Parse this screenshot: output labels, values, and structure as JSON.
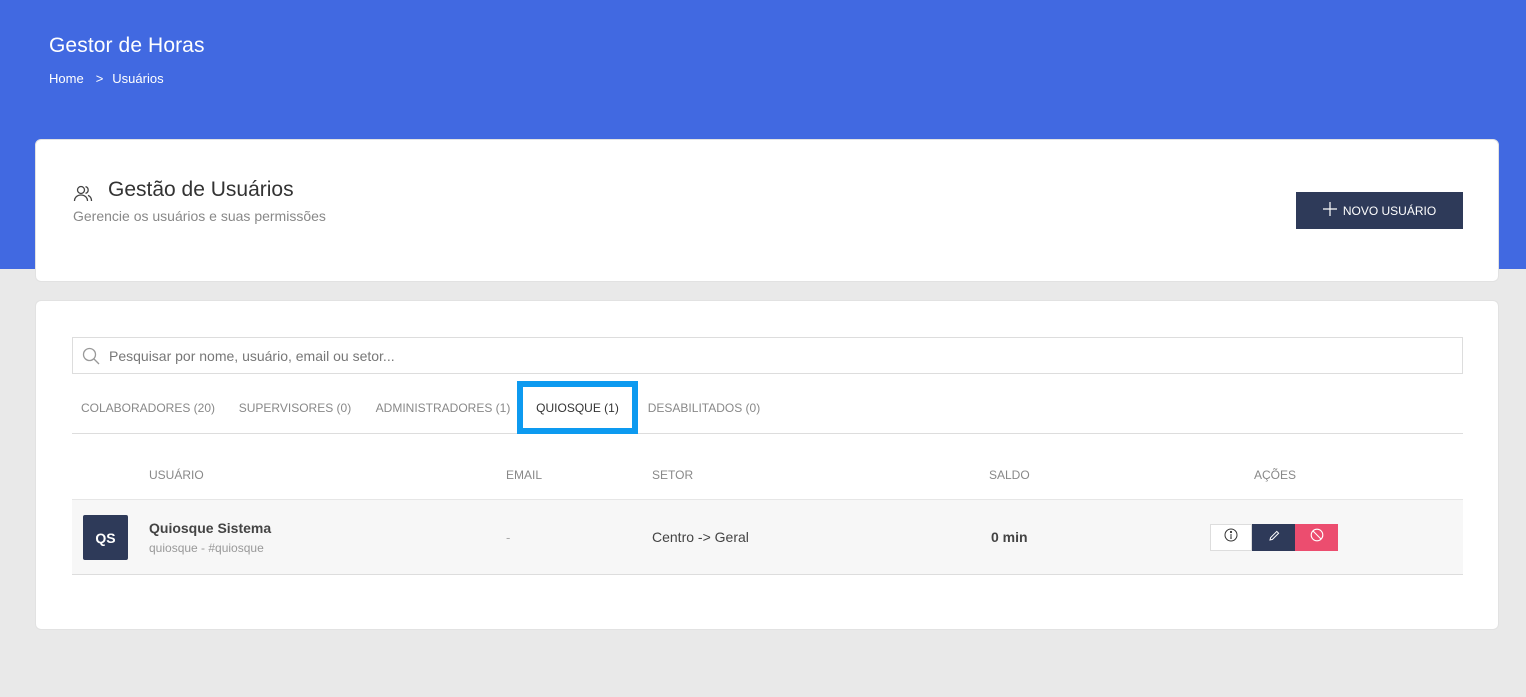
{
  "app": {
    "title": "Gestor de Horas"
  },
  "breadcrumb": {
    "home": "Home",
    "separator": ">",
    "current": "Usuários"
  },
  "header": {
    "title": "Gestão de Usuários",
    "subtitle": "Gerencie os usuários e suas permissões",
    "icon": "users-icon",
    "new_user_label": "NOVO USUÁRIO"
  },
  "search": {
    "placeholder": "Pesquisar por nome, usuário, email ou setor...",
    "value": ""
  },
  "tabs": [
    {
      "label": "COLABORADORES (20)",
      "active": false
    },
    {
      "label": "SUPERVISORES (0)",
      "active": false
    },
    {
      "label": "ADMINISTRADORES (1)",
      "active": false
    },
    {
      "label": "QUIOSQUE (1)",
      "active": true
    },
    {
      "label": "DESABILITADOS (0)",
      "active": false
    }
  ],
  "table": {
    "columns": {
      "user": "USUÁRIO",
      "email": "EMAIL",
      "sector": "SETOR",
      "balance": "SALDO",
      "actions": "AÇÕES"
    },
    "rows": [
      {
        "initials": "QS",
        "name": "Quiosque Sistema",
        "handle": "quiosque - #quiosque",
        "email": "-",
        "sector": "Centro -> Geral",
        "balance": "0 min"
      }
    ]
  },
  "colors": {
    "brand": "#4169e1",
    "dark": "#2e3a59",
    "danger": "#ec4d6f",
    "highlight": "#0d9af0"
  }
}
